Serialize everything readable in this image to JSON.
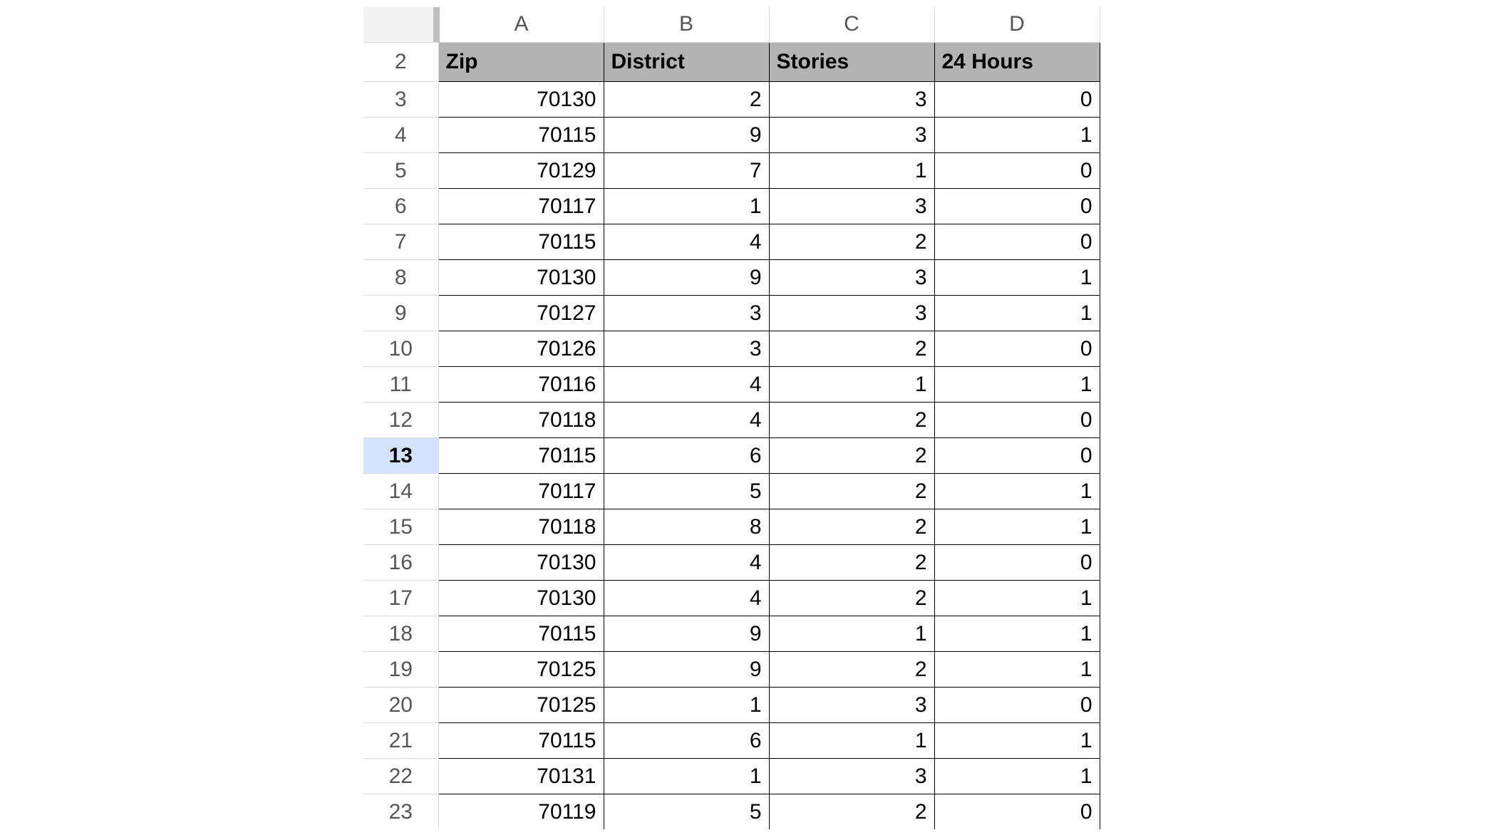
{
  "columns": {
    "letters": [
      "A",
      "B",
      "C",
      "D"
    ],
    "headers": [
      "Zip",
      "District",
      "Stories",
      "24 Hours"
    ]
  },
  "selectedRow": 13,
  "rows": [
    {
      "n": 3,
      "c": [
        "70130",
        "2",
        "3",
        "0"
      ]
    },
    {
      "n": 4,
      "c": [
        "70115",
        "9",
        "3",
        "1"
      ]
    },
    {
      "n": 5,
      "c": [
        "70129",
        "7",
        "1",
        "0"
      ]
    },
    {
      "n": 6,
      "c": [
        "70117",
        "1",
        "3",
        "0"
      ]
    },
    {
      "n": 7,
      "c": [
        "70115",
        "4",
        "2",
        "0"
      ]
    },
    {
      "n": 8,
      "c": [
        "70130",
        "9",
        "3",
        "1"
      ]
    },
    {
      "n": 9,
      "c": [
        "70127",
        "3",
        "3",
        "1"
      ]
    },
    {
      "n": 10,
      "c": [
        "70126",
        "3",
        "2",
        "0"
      ]
    },
    {
      "n": 11,
      "c": [
        "70116",
        "4",
        "1",
        "1"
      ]
    },
    {
      "n": 12,
      "c": [
        "70118",
        "4",
        "2",
        "0"
      ]
    },
    {
      "n": 13,
      "c": [
        "70115",
        "6",
        "2",
        "0"
      ]
    },
    {
      "n": 14,
      "c": [
        "70117",
        "5",
        "2",
        "1"
      ]
    },
    {
      "n": 15,
      "c": [
        "70118",
        "8",
        "2",
        "1"
      ]
    },
    {
      "n": 16,
      "c": [
        "70130",
        "4",
        "2",
        "0"
      ]
    },
    {
      "n": 17,
      "c": [
        "70130",
        "4",
        "2",
        "1"
      ]
    },
    {
      "n": 18,
      "c": [
        "70115",
        "9",
        "1",
        "1"
      ]
    },
    {
      "n": 19,
      "c": [
        "70125",
        "9",
        "2",
        "1"
      ]
    },
    {
      "n": 20,
      "c": [
        "70125",
        "1",
        "3",
        "0"
      ]
    },
    {
      "n": 21,
      "c": [
        "70115",
        "6",
        "1",
        "1"
      ]
    },
    {
      "n": 22,
      "c": [
        "70131",
        "1",
        "3",
        "1"
      ]
    },
    {
      "n": 23,
      "c": [
        "70119",
        "5",
        "2",
        "0"
      ]
    }
  ]
}
